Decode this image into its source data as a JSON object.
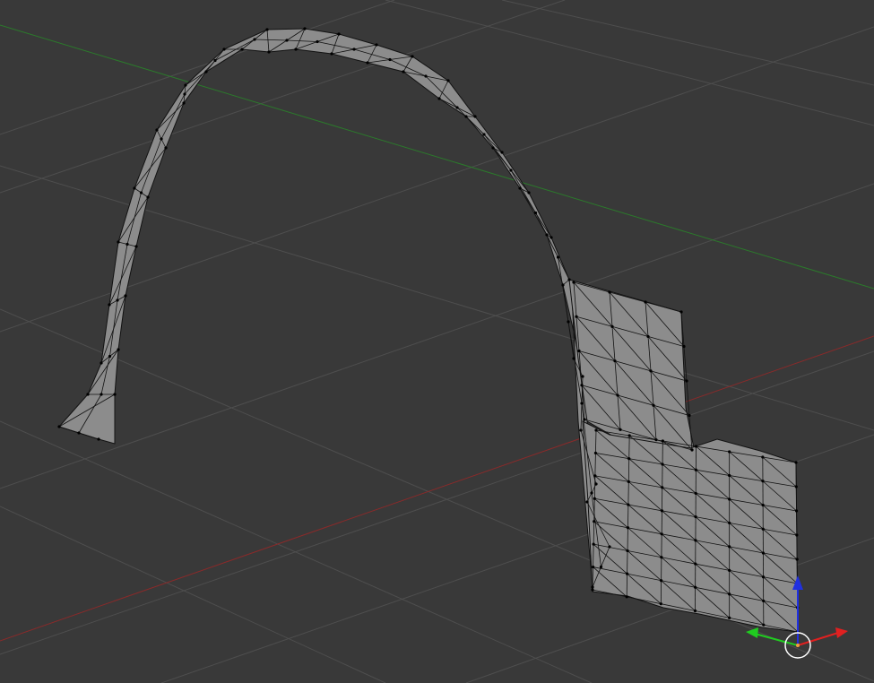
{
  "viewport": {
    "background_color": "#393939",
    "grid_color": "#4e4e4e",
    "x_axis_color": "#8a2a2a",
    "y_axis_color": "#2b7a2b",
    "mesh_face_color": "#8c8c8c",
    "mesh_edge_color": "#121212",
    "gizmo": {
      "x_handle_color": "#e02020",
      "y_handle_color": "#20cc20",
      "z_handle_color": "#2030e0",
      "origin_cursor_icon": "3d-cursor-icon"
    }
  }
}
